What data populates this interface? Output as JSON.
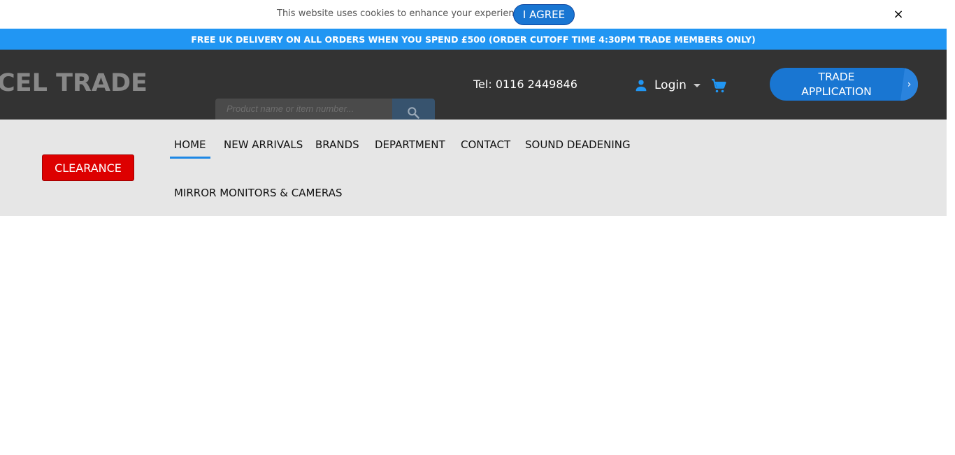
{
  "cookie": {
    "message": "This website uses cookies to enhance your experience.",
    "agree_label": "I AGREE",
    "close_symbol": "×"
  },
  "promo": {
    "text": "FREE UK DELIVERY ON ALL ORDERS WHEN YOU SPEND £500 (ORDER CUTOFF TIME 4:30PM TRADE MEMBERS ONLY)"
  },
  "header": {
    "logo_text": "CEL TRADE",
    "search_placeholder": "Product name or item number...",
    "search_icon": "search-icon",
    "tel": "Tel: 0116 2449846",
    "login_label": "Login",
    "login_icon": "person-icon",
    "cart_icon": "cart-icon",
    "trade_label_line1": "TRADE",
    "trade_label_line2": "APPLICATION",
    "trade_arrow": "›"
  },
  "nav": {
    "clearance_label": "CLEARANCE",
    "items": [
      {
        "label": "HOME",
        "active": true
      },
      {
        "label": "NEW ARRIVALS",
        "active": false
      },
      {
        "label": "BRANDS",
        "active": false
      },
      {
        "label": "DEPARTMENT",
        "active": false
      },
      {
        "label": "CONTACT",
        "active": false
      },
      {
        "label": "SOUND DEADENING",
        "active": false
      },
      {
        "label": "MIRROR MONITORS & CAMERAS",
        "active": false
      }
    ]
  },
  "colors": {
    "accent_blue": "#2196f3",
    "button_blue": "#1976d2",
    "header_bg": "#333333",
    "nav_bg": "#e6e6e6",
    "clearance_red": "#dd0000"
  }
}
